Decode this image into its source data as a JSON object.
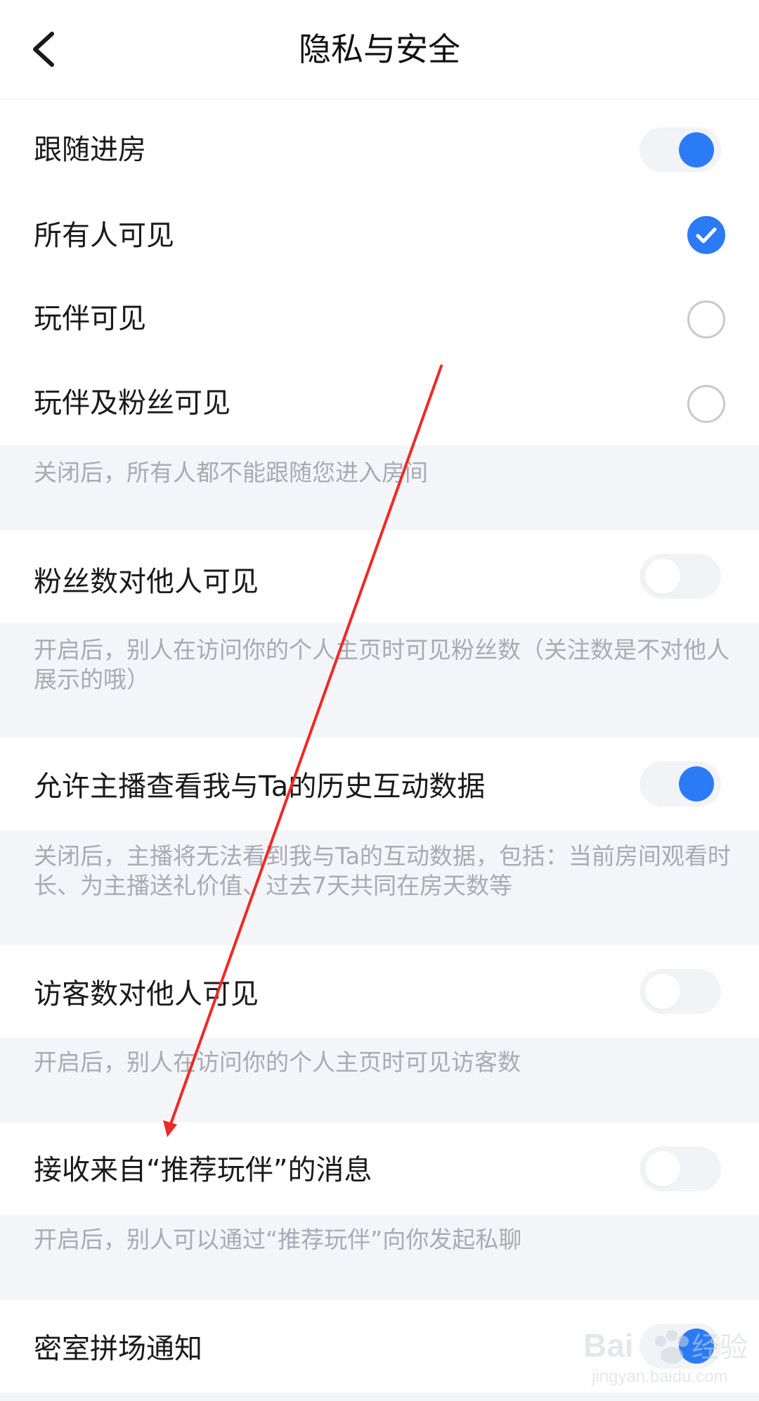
{
  "header": {
    "title": "隐私与安全",
    "back_icon": "chevron-left-icon"
  },
  "settings": {
    "follow_room": {
      "label": "跟随进房",
      "enabled": true
    },
    "visibility_options": [
      {
        "label": "所有人可见",
        "selected": true
      },
      {
        "label": "玩伴可见",
        "selected": false
      },
      {
        "label": "玩伴及粉丝可见",
        "selected": false
      }
    ],
    "follow_room_desc": "关闭后，所有人都不能跟随您进入房间",
    "fans_visible": {
      "label": "粉丝数对他人可见",
      "enabled": false,
      "desc": "开启后，别人在访问你的个人主页时可见粉丝数（关注数是不对他人展示的哦）"
    },
    "host_history": {
      "label": "允许主播查看我与Ta的历史互动数据",
      "enabled": true,
      "desc": "关闭后，主播将无法看到我与Ta的互动数据，包括：当前房间观看时长、为主播送礼价值、过去7天共同在房天数等"
    },
    "visitors_visible": {
      "label": "访客数对他人可见",
      "enabled": false,
      "desc": "开启后，别人在访问你的个人主页时可见访客数"
    },
    "recommend_messages": {
      "label": "接收来自“推荐玩伴”的消息",
      "enabled": false,
      "desc": "开启后，别人可以通过“推荐玩伴”向你发起私聊"
    },
    "escape_room": {
      "label": "密室拼场通知",
      "enabled": true
    }
  },
  "colors": {
    "accent": "#2b7bf6",
    "annotation_arrow": "#ee2a24",
    "desc_background": "#f4f5f9",
    "desc_text": "#a8abb3"
  },
  "watermark": {
    "brand": "Bai经验",
    "url": "jingyan.baidu.com"
  }
}
